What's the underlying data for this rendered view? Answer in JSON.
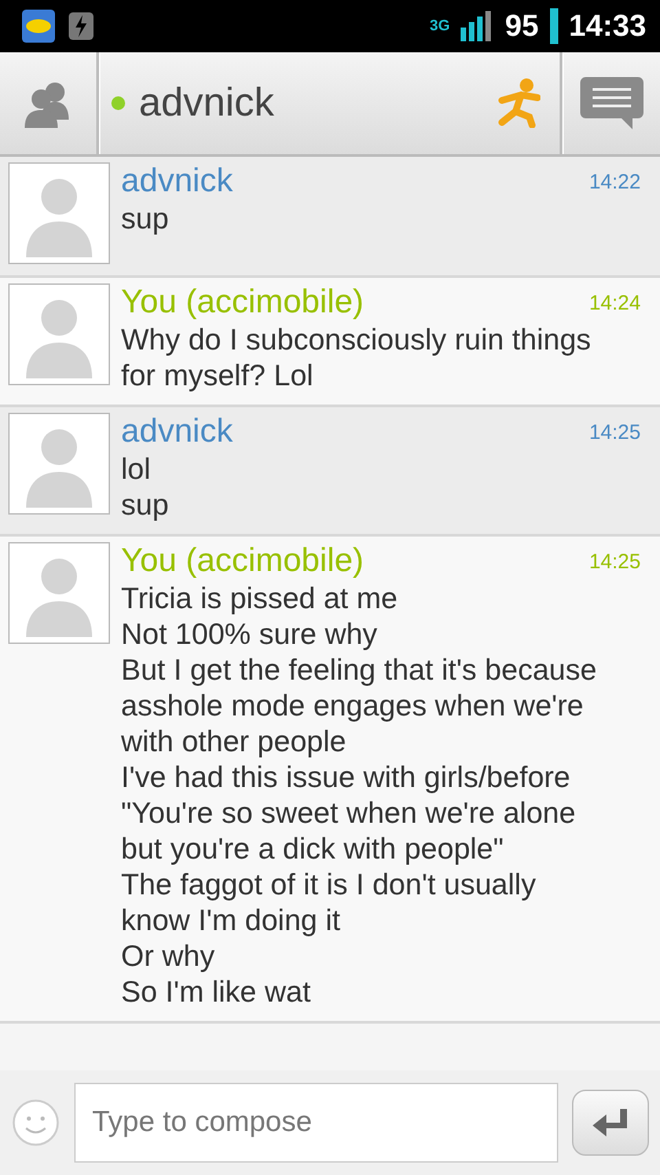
{
  "status_bar": {
    "network": "3G",
    "battery": "95",
    "time": "14:33"
  },
  "header": {
    "contact": "advnick",
    "online": true
  },
  "messages": [
    {
      "kind": "them",
      "sender": "advnick",
      "time": "14:22",
      "lines": [
        "sup"
      ]
    },
    {
      "kind": "me",
      "sender": "You (accimobile)",
      "time": "14:24",
      "lines": [
        "Why do I subconsciously ruin things",
        "for myself? Lol"
      ]
    },
    {
      "kind": "them",
      "sender": "advnick",
      "time": "14:25",
      "lines": [
        "lol",
        "sup"
      ]
    },
    {
      "kind": "me",
      "sender": "You (accimobile)",
      "time": "14:25",
      "lines": [
        "Tricia is pissed at me",
        "Not 100% sure why",
        "But I get the feeling that it's because",
        "asshole mode engages when we're",
        "with other people",
        "I've had this issue with girls/before",
        "\"You're so sweet when we're alone",
        "but you're a dick with people\"",
        "The faggot of it is I don't usually",
        "know I'm doing it",
        "Or why",
        "So I'm like wat"
      ]
    }
  ],
  "compose": {
    "placeholder": "Type to compose"
  }
}
